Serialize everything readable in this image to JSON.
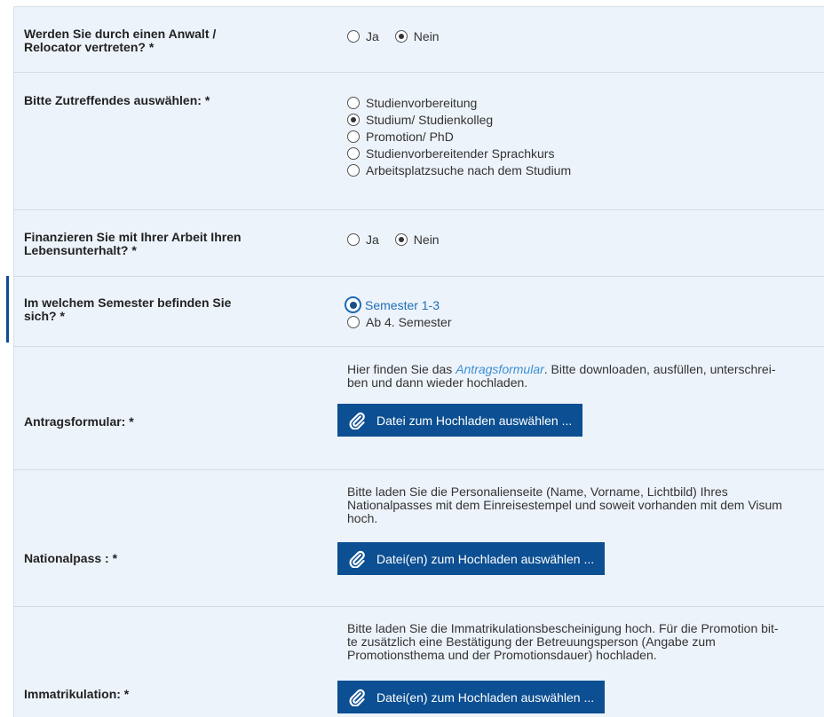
{
  "required_mark": "*",
  "rows": {
    "anwalt": {
      "label_line1": "Werden Sie durch einen Anwalt /",
      "label_line2": "Relocator vertreten?",
      "options": [
        "Ja",
        "Nein"
      ],
      "selected": "Nein"
    },
    "zutreffend": {
      "label": "Bitte Zutreffendes auswählen:",
      "options": [
        "Studienvorbereitung",
        "Studium/ Studienkolleg",
        "Promotion/ PhD",
        "Studienvorbereitender Sprachkurs",
        "Arbeitsplatzsuche nach dem Studium"
      ],
      "selected": "Studium/ Studienkolleg"
    },
    "finanzieren": {
      "label_line1": "Finanzieren Sie mit Ihrer Arbeit Ihren",
      "label_line2": "Lebensunterhalt?",
      "options": [
        "Ja",
        "Nein"
      ],
      "selected": "Nein"
    },
    "semester": {
      "label_line1": "Im welchem Semester befinden Sie",
      "label_line2": "sich?",
      "options": [
        "Semester 1-3",
        "Ab 4. Semester"
      ],
      "selected": "Semester 1-3"
    },
    "antrag": {
      "label": "Antragsformular:",
      "help_prefix": "Hier finden Sie das ",
      "help_link": "Antragsformular",
      "help_suffix": ". Bitte downloaden, ausfüllen, unterschrei-",
      "help_line2": "ben und dann wieder hochladen.",
      "button": "Datei zum Hochladen auswählen ..."
    },
    "pass": {
      "label": "Nationalpass :",
      "help_line1": "Bitte laden Sie die Personalienseite (Name, Vorname, Lichtbild) Ihres",
      "help_line2": "Nationalpasses mit dem Einreisestempel und soweit vorhanden mit dem Visum",
      "help_line3": "hoch.",
      "button": "Datei(en) zum Hochladen auswählen ..."
    },
    "immatrikulation": {
      "label": "Immatrikulation:",
      "help_line1": "Bitte laden Sie die Immatrikulationsbescheinigung hoch. Für die Promotion bit-",
      "help_line2": "te zusätzlich eine Bestätigung der Betreuungsperson (Angabe zum",
      "help_line3": "Promotionsthema und der Promotionsdauer) hochladen.",
      "button": "Datei(en) zum Hochladen auswählen ..."
    }
  },
  "icons": {
    "upload": "paperclip-icon"
  }
}
